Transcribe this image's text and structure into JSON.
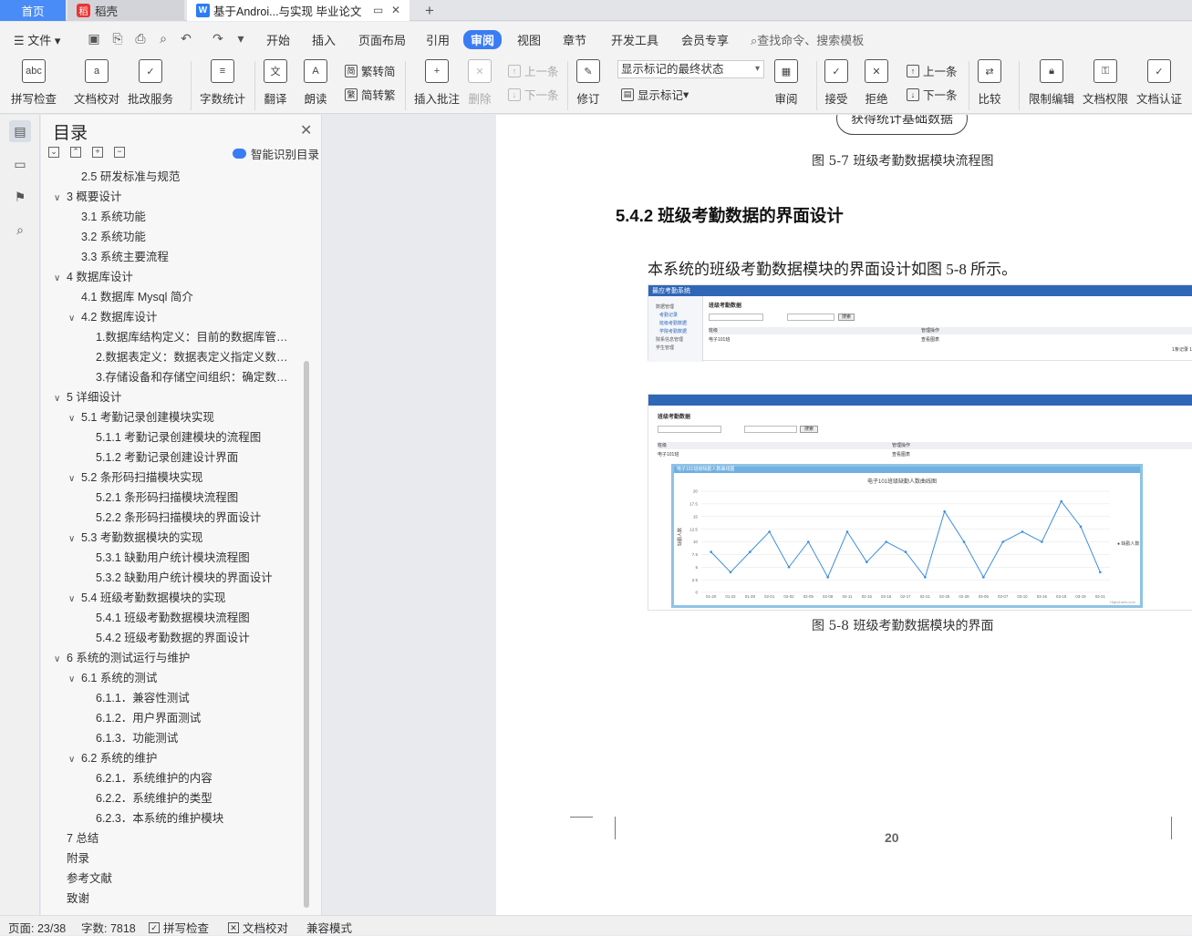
{
  "tabs": {
    "home": "首页",
    "daoke": "稻壳",
    "doc": "基于Androi...与实现 毕业论文"
  },
  "menu": {
    "file": "文件",
    "items": [
      "开始",
      "插入",
      "页面布局",
      "引用",
      "审阅",
      "视图",
      "章节",
      "开发工具",
      "会员专享"
    ],
    "active": "审阅",
    "search": "查找命令、搜索模板"
  },
  "ribbon": {
    "spell": "拼写检查",
    "proof": "文档校对",
    "approve": "批改服务",
    "wordcount": "字数统计",
    "translate": "翻译",
    "read": "朗读",
    "trad": "繁转简",
    "simp": "简转繁",
    "insert_comment": "插入批注",
    "delete": "删除",
    "prev": "上一条",
    "next": "下一条",
    "revise": "修订",
    "show_state": "显示标记的最终状态",
    "show_marks": "显示标记",
    "review": "审阅",
    "accept": "接受",
    "reject": "拒绝",
    "prev2": "上一条",
    "next2": "下一条",
    "compare": "比较",
    "restrict": "限制编辑",
    "perm": "文档权限",
    "auth": "文档认证"
  },
  "toc": {
    "title": "目录",
    "smart": "智能识别目录",
    "items": [
      {
        "t": "2.5 研发标准与规范",
        "lv": 2,
        "car": ""
      },
      {
        "t": "3 概要设计",
        "lv": 1,
        "car": "v"
      },
      {
        "t": "3.1 系统功能",
        "lv": 2,
        "car": ""
      },
      {
        "t": "3.2 系统功能",
        "lv": 2,
        "car": ""
      },
      {
        "t": "3.3 系统主要流程",
        "lv": 2,
        "car": ""
      },
      {
        "t": "4 数据库设计",
        "lv": 1,
        "car": "v"
      },
      {
        "t": "4.1 数据库 Mysql 简介",
        "lv": 2,
        "car": ""
      },
      {
        "t": "4.2 数据库设计",
        "lv": 2,
        "car": "v"
      },
      {
        "t": "1.数据库结构定义：目前的数据库管理 ...",
        "lv": 3,
        "car": ""
      },
      {
        "t": "2.数据表定义：数据表定义指定义数据 ...",
        "lv": 3,
        "car": ""
      },
      {
        "t": "3.存储设备和存储空间组织：确定数据 ...",
        "lv": 3,
        "car": ""
      },
      {
        "t": "5 详细设计",
        "lv": 1,
        "car": "v"
      },
      {
        "t": "5.1 考勤记录创建模块实现",
        "lv": 2,
        "car": "v"
      },
      {
        "t": "5.1.1 考勤记录创建模块的流程图",
        "lv": 3,
        "car": ""
      },
      {
        "t": "5.1.2 考勤记录创建设计界面",
        "lv": 3,
        "car": ""
      },
      {
        "t": "5.2 条形码扫描模块实现",
        "lv": 2,
        "car": "v"
      },
      {
        "t": "5.2.1 条形码扫描模块流程图",
        "lv": 3,
        "car": ""
      },
      {
        "t": "5.2.2 条形码扫描模块的界面设计",
        "lv": 3,
        "car": ""
      },
      {
        "t": "5.3 考勤数据模块的实现",
        "lv": 2,
        "car": "v"
      },
      {
        "t": "5.3.1 缺勤用户统计模块流程图",
        "lv": 3,
        "car": ""
      },
      {
        "t": "5.3.2 缺勤用户统计模块的界面设计",
        "lv": 3,
        "car": ""
      },
      {
        "t": "5.4 班级考勤数据模块的实现",
        "lv": 2,
        "car": "v"
      },
      {
        "t": "5.4.1 班级考勤数据模块流程图",
        "lv": 3,
        "car": ""
      },
      {
        "t": "5.4.2 班级考勤数据的界面设计",
        "lv": 3,
        "car": ""
      },
      {
        "t": "6 系统的测试运行与维护",
        "lv": 1,
        "car": "v"
      },
      {
        "t": "6.1 系统的测试",
        "lv": 2,
        "car": "v"
      },
      {
        "t": "6.1.1．兼容性测试",
        "lv": 3,
        "car": ""
      },
      {
        "t": "6.1.2．用户界面测试",
        "lv": 3,
        "car": ""
      },
      {
        "t": "6.1.3．功能测试",
        "lv": 3,
        "car": ""
      },
      {
        "t": "6.2 系统的维护",
        "lv": 2,
        "car": "v"
      },
      {
        "t": "6.2.1．系统维护的内容",
        "lv": 3,
        "car": ""
      },
      {
        "t": "6.2.2．系统维护的类型",
        "lv": 3,
        "car": ""
      },
      {
        "t": "6.2.3．本系统的维护模块",
        "lv": 3,
        "car": ""
      },
      {
        "t": "7 总结",
        "lv": 1,
        "car": ""
      },
      {
        "t": "附录",
        "lv": 1,
        "car": ""
      },
      {
        "t": "参考文献",
        "lv": 1,
        "car": ""
      },
      {
        "t": "致谢",
        "lv": 1,
        "car": ""
      }
    ]
  },
  "doc": {
    "flow_label": "获得统计基础数据",
    "fig57": "图 5-7 班级考勤数据模块流程图",
    "heading": "5.4.2 班级考勤数据的界面设计",
    "para": "本系统的班级考勤数据模块的界面设计如图 5-8 所示。",
    "fig58": "图 5-8 班级考勤数据模块的界面",
    "page_no": "20",
    "shot1": {
      "app": "最应考勤系统",
      "side": [
        "数据管理",
        "考勤记录",
        "班级考勤数据",
        "学院考勤数据",
        "院系信息管理",
        "学生管理"
      ],
      "title": "班级考勤数据",
      "col1": "班级",
      "col2": "管理操作",
      "row1": "电子101班",
      "row2": "查看图表",
      "btn": "搜索",
      "total": "1条记录 1"
    },
    "shot2": {
      "title": "班级考勤数据",
      "col1": "班级",
      "col2": "管理操作",
      "row1": "电子101班",
      "row2": "查看图表",
      "btn": "搜索",
      "popup": "电子101班级缺勤人数曲线图",
      "legend": "缺勤人数",
      "ylabel": "缺勤人数",
      "credit": "Highcharts.com"
    }
  },
  "chart_data": {
    "type": "line",
    "title": "电子101班级缺勤人数曲线图",
    "ylabel": "缺勤人数",
    "ylim": [
      0,
      20
    ],
    "yticks": [
      0,
      2.5,
      5,
      7.5,
      10,
      12.5,
      15,
      17.5,
      20
    ],
    "categories": [
      "01-20",
      "01-22",
      "01-28",
      "02-01",
      "02-02",
      "02-05",
      "02-08",
      "02-11",
      "02-15",
      "02-16",
      "02-17",
      "02-21",
      "02-25",
      "02-28",
      "03-06",
      "03-07",
      "03-10",
      "03-16",
      "03-18",
      "03-19",
      "03-21"
    ],
    "series": [
      {
        "name": "缺勤人数",
        "values": [
          8,
          4,
          8,
          12,
          5,
          10,
          3,
          12,
          6,
          10,
          8,
          3,
          16,
          10,
          3,
          10,
          12,
          10,
          18,
          13,
          4
        ]
      }
    ]
  },
  "statusbar": {
    "page": "页面: 23/38",
    "words": "字数: 7818",
    "spell": "拼写检查",
    "proof": "文档校对",
    "compat": "兼容模式"
  }
}
